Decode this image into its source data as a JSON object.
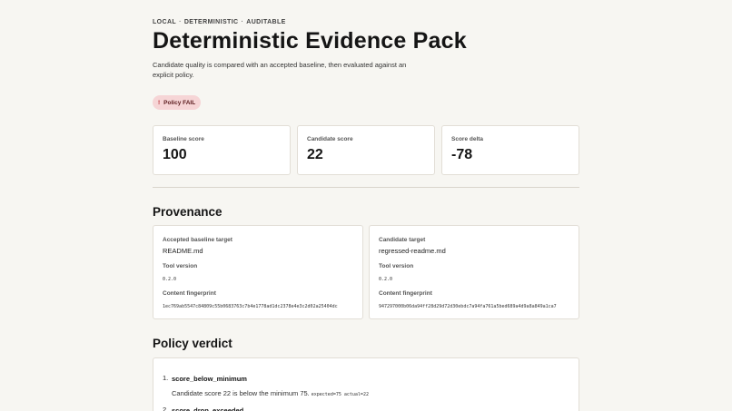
{
  "eyebrow": [
    "LOCAL",
    "DETERMINISTIC",
    "AUDITABLE"
  ],
  "eyebrow_separator": "·",
  "title": "Deterministic Evidence Pack",
  "subtitle": "Candidate quality is compared with an accepted baseline, then evaluated against an explicit policy.",
  "badge": {
    "icon": "!",
    "label": "Policy FAIL",
    "background": "#f6d5d6",
    "icon_color": "#b3262d"
  },
  "scores": [
    {
      "label": "Baseline score",
      "value": "100"
    },
    {
      "label": "Candidate score",
      "value": "22"
    },
    {
      "label": "Score delta",
      "value": "-78"
    }
  ],
  "provenance": {
    "title": "Provenance",
    "baseline": {
      "target_label": "Accepted baseline target",
      "target_value": "README.md",
      "tool_label": "Tool version",
      "tool_value": "0.2.0",
      "fingerprint_label": "Content fingerprint",
      "fingerprint_value": "1ec769ab5547c84809c55b0683763c7b4e1778ad1dc2378e4e3c2d02a25404dc"
    },
    "candidate": {
      "target_label": "Candidate target",
      "target_value": "regressed-readme.md",
      "tool_label": "Tool version",
      "tool_value": "0.2.0",
      "fingerprint_label": "Content fingerprint",
      "fingerprint_value": "947297000b06da94ff28d29d72d30ebdc7a94fa761a5bed689a4d9a8a849a1ca7"
    }
  },
  "verdict": {
    "title": "Policy verdict",
    "items": [
      {
        "number": "1.",
        "code": "score_below_minimum",
        "detail": "Candidate score 22 is below the minimum 75.",
        "kv": "expected=75 actual=22"
      },
      {
        "number": "2.",
        "code": "score_drop_exceeded",
        "detail": "",
        "kv": ""
      }
    ]
  }
}
